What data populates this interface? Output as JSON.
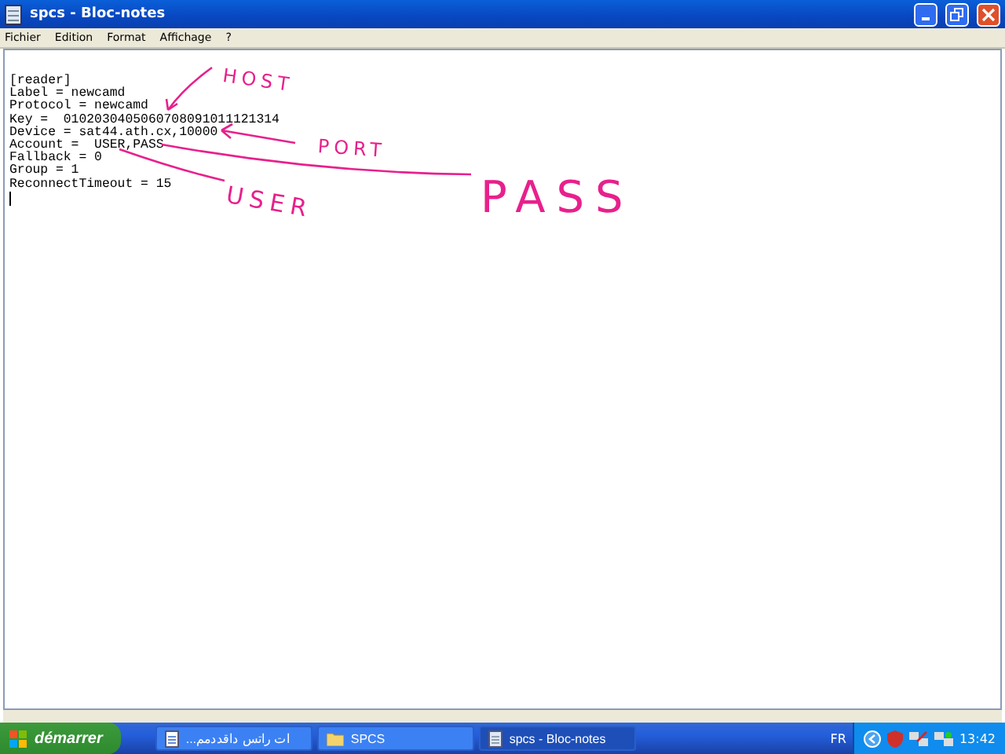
{
  "window": {
    "title": "spcs - Bloc-notes"
  },
  "menu": [
    "Fichier",
    "Edition",
    "Format",
    "Affichage",
    "?"
  ],
  "document": {
    "lines": [
      "[reader]",
      "Label = newcamd",
      "Protocol = newcamd",
      "Key =  0102030405060708091011121314",
      "Device = sat44.ath.cx,10000",
      "Account =  USER,PASS",
      "Fallback = 0",
      "Group = 1",
      "ReconnectTimeout = 15"
    ]
  },
  "annotations": [
    {
      "kind": "host",
      "text": "HOST"
    },
    {
      "kind": "port",
      "text": "PORT"
    },
    {
      "kind": "pass",
      "text": "PASS"
    },
    {
      "kind": "user",
      "text": "USER"
    }
  ],
  "taskbar": {
    "start": "démarrer",
    "tasks": [
      {
        "label": "...ات راتس داقددمم",
        "kind": "doc",
        "selected": false
      },
      {
        "label": "SPCS",
        "kind": "folder",
        "selected": false
      },
      {
        "label": "spcs - Bloc-notes",
        "kind": "notepad",
        "selected": true
      }
    ],
    "language": "FR",
    "clock": "13:42"
  }
}
